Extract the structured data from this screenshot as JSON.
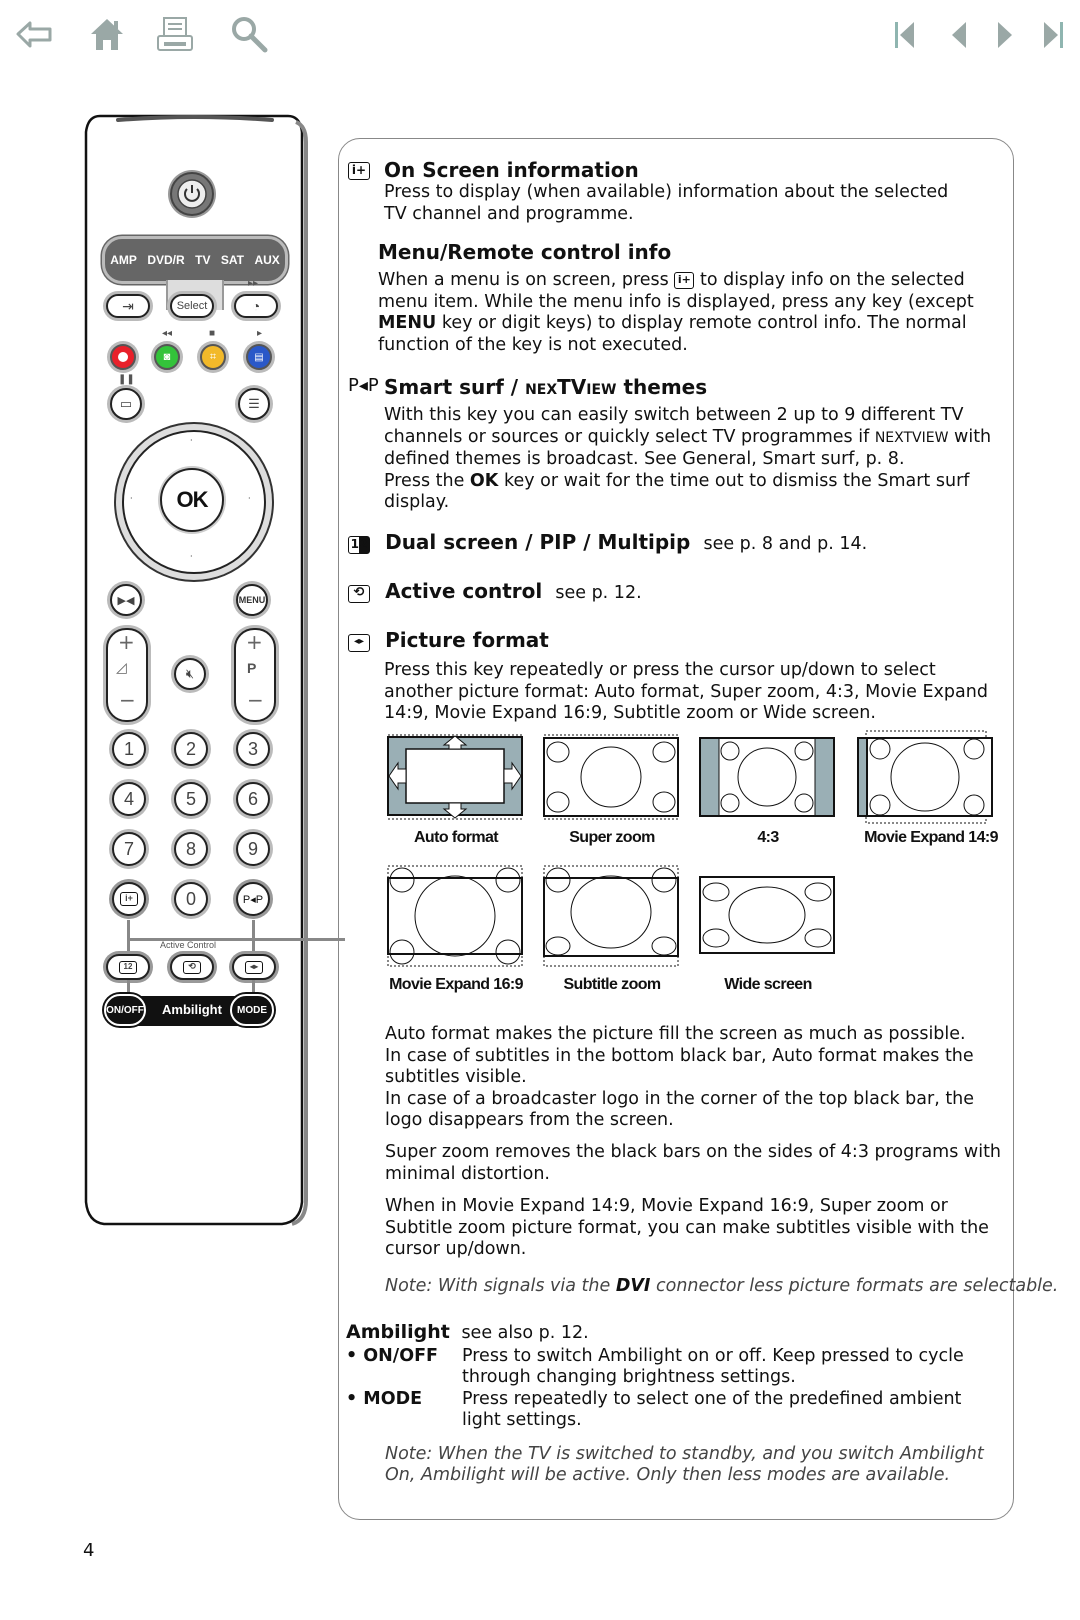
{
  "toolbar": {
    "left": [
      {
        "name": "back-arrow-icon",
        "label": "Back"
      },
      {
        "name": "home-icon",
        "label": "Home"
      },
      {
        "name": "print-icon",
        "label": "Print"
      },
      {
        "name": "search-icon",
        "label": "Search"
      }
    ],
    "right": [
      {
        "name": "first-page-icon",
        "label": "First page"
      },
      {
        "name": "previous-page-icon",
        "label": "Previous page"
      },
      {
        "name": "next-page-icon",
        "label": "Next page"
      },
      {
        "name": "last-page-icon",
        "label": "Last page"
      }
    ],
    "icon_color": "#9aa8a6"
  },
  "remote": {
    "source_bar": [
      "AMP",
      "DVD/R",
      "TV",
      "SAT",
      "AUX"
    ],
    "select_label": "Select",
    "fast_forward_label": "▸▸",
    "rewind_label": "◂◂",
    "stop_label": "■",
    "play_label": "▸",
    "pause_label": "❚❚",
    "color_keys": [
      {
        "name": "red",
        "color": "#e8202a"
      },
      {
        "name": "green",
        "color": "#33c33a"
      },
      {
        "name": "yellow",
        "color": "#f2b92a"
      },
      {
        "name": "blue",
        "color": "#2a58c8"
      }
    ],
    "ok_label": "OK",
    "menu_label": "MENU",
    "volume_plus": "+",
    "volume_minus": "−",
    "program_plus": "+",
    "program_label": "P",
    "program_minus": "−",
    "digits": [
      "1",
      "2",
      "3",
      "4",
      "5",
      "6",
      "7",
      "8",
      "9"
    ],
    "zero": "0",
    "info_label": "i+",
    "smart_surf_label": "P◂P",
    "active_control_label": "Active Control",
    "dual_label": "12",
    "ambilight_onoff": "ON/OFF",
    "ambilight_label": "Ambilight",
    "ambilight_mode": "MODE"
  },
  "sections": {
    "onscreen": {
      "icon_label": "i+",
      "title": "On Screen information",
      "body": "Press to display (when available) information about the selected TV channel and programme."
    },
    "menu_info": {
      "title": "Menu/Remote control info",
      "body_1": "When a menu is on screen, press",
      "body_icon": "i+",
      "body_2": "to display info on the selected menu item. While the menu info is displayed, press any key (except",
      "body_bold": "MENU",
      "body_3": "key or digit keys) to display remote control info. The normal function of the key is not executed."
    },
    "smart_surf": {
      "icon_label": "P◂P",
      "title_1": "Smart surf / ",
      "title_nex": "nex",
      "title_tv": "TV",
      "title_iew": "iew",
      "title_2": " themes",
      "body_1": "With this key you can easily switch between 2 up to 9 different TV channels or sources or quickly select TV programmes if",
      "body_nex": "NEXTVIEW",
      "body_2": "with defined themes is broadcast. See General, Smart surf, p. 8.",
      "body_3a": "Press the",
      "body_3b": "OK",
      "body_3c": "key or wait for the time out to dismiss the Smart surf display."
    },
    "dual": {
      "icon_label": "12",
      "title": "Dual screen / PIP / Multipip",
      "ref": "see p. 8 and p. 14."
    },
    "active": {
      "title": "Active control",
      "ref": "see p. 12."
    },
    "picture": {
      "title": "Picture format",
      "body": "Press this key repeatedly or press the cursor up/down to select another picture format: Auto format, Super zoom, 4:3, Movie Expand 14:9, Movie Expand 16:9, Subtitle zoom or Wide screen.",
      "formats_row1": [
        "Auto format",
        "Super zoom",
        "4:3",
        "Movie Expand 14:9"
      ],
      "formats_row2": [
        "Movie Expand 16:9",
        "Subtitle zoom",
        "Wide screen"
      ],
      "bar_color": "#9aafb5",
      "auto_para_1": "Auto format makes the picture fill the screen as much as possible.",
      "auto_para_2": "In case of subtitles in the bottom black bar, Auto format makes the subtitles visible.",
      "auto_para_3": "In case of a broadcaster logo in the corner of the top black bar, the logo disappears from the screen.",
      "superzoom_para": "Super zoom removes the black bars on the sides of 4:3 programs with minimal distortion.",
      "movie_para": "When in Movie Expand 14:9, Movie Expand 16:9, Super zoom or Subtitle zoom picture format, you can make subtitles visible with the cursor up/down.",
      "note_1": "Note: With signals via the",
      "note_bold": "DVI",
      "note_2": "connector less picture formats are selectable."
    },
    "ambilight": {
      "title": "Ambilight",
      "ref": "see also p. 12.",
      "items": [
        {
          "key": "• ON/OFF",
          "desc": "Press to switch Ambilight on or off. Keep pressed to cycle through changing brightness settings."
        },
        {
          "key": "• MODE",
          "desc": "Press repeatedly to select one of the predefined ambient light settings."
        }
      ],
      "note": "Note: When the TV is switched to standby, and you switch Ambilight On, Ambilight will be active. Only then less modes are available."
    }
  },
  "page_number": "4"
}
